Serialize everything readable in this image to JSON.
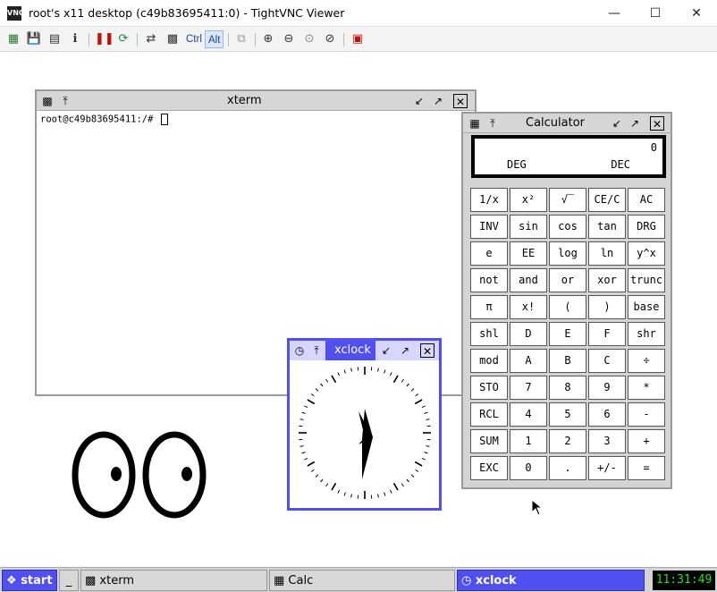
{
  "window": {
    "app_icon_text": "VNC",
    "title": "root's x11 desktop (c49b83695411:0) - TightVNC Viewer",
    "controls": [
      "minimize-icon",
      "maximize-icon",
      "close-icon"
    ]
  },
  "toolbar": {
    "buttons": [
      "new-connection-icon",
      "save-icon",
      "options-icon",
      "info-icon",
      "pause-icon",
      "refresh-icon",
      "transfer-icon",
      "ctrl-alt-del-icon"
    ],
    "ctrl_label": "Ctrl",
    "alt_label": "Alt",
    "zoom_buttons": [
      "zoom-in-icon",
      "zoom-out-icon",
      "zoom-100-icon",
      "zoom-auto-icon"
    ],
    "fullscreen_icon": "fullscreen-icon"
  },
  "xterm": {
    "title": "xterm",
    "prompt": "root@c49b83695411:/# "
  },
  "calculator": {
    "title": "Calculator",
    "display_value": "0",
    "angle_mode": "DEG",
    "base_mode": "DEC",
    "keys": [
      [
        "1/x",
        "x²",
        "√‾",
        "CE/C",
        "AC"
      ],
      [
        "INV",
        "sin",
        "cos",
        "tan",
        "DRG"
      ],
      [
        "e",
        "EE",
        "log",
        "ln",
        "y^x"
      ],
      [
        "not",
        "and",
        "or",
        "xor",
        "trunc"
      ],
      [
        "π",
        "x!",
        "(",
        ")",
        "base"
      ],
      [
        "shl",
        "D",
        "E",
        "F",
        "shr"
      ],
      [
        "mod",
        "A",
        "B",
        "C",
        "÷"
      ],
      [
        "STO",
        "7",
        "8",
        "9",
        "*"
      ],
      [
        "RCL",
        "4",
        "5",
        "6",
        "-"
      ],
      [
        "SUM",
        "1",
        "2",
        "3",
        "+"
      ],
      [
        "EXC",
        "0",
        ".",
        "+/-",
        "="
      ]
    ]
  },
  "xclock": {
    "title": "xclock"
  },
  "taskbar": {
    "start_label": "start",
    "show_desktop_label": "_",
    "tasks": [
      {
        "label": "xterm",
        "icon": "terminal-icon"
      },
      {
        "label": "Calc",
        "icon": "calculator-icon"
      },
      {
        "label": "xclock",
        "icon": "clock-icon"
      }
    ],
    "clock": "11:31:49"
  },
  "colors": {
    "active_title": "#5050f0",
    "inactive_title": "#d6d6d6",
    "tray_clock_fg": "#20e020"
  }
}
